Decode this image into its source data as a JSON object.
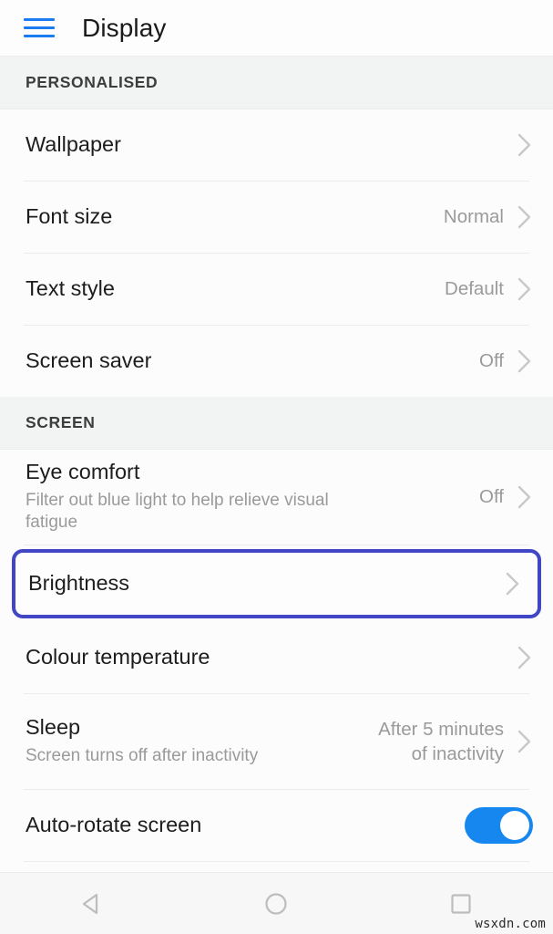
{
  "app": {
    "title": "Display",
    "menu_icon": "hamburger-menu-icon"
  },
  "sections": [
    {
      "header": "PERSONALISED",
      "rows": [
        {
          "title": "Wallpaper",
          "subtitle": "",
          "value": "",
          "accessory": "chevron"
        },
        {
          "title": "Font size",
          "subtitle": "",
          "value": "Normal",
          "accessory": "chevron"
        },
        {
          "title": "Text style",
          "subtitle": "",
          "value": "Default",
          "accessory": "chevron"
        },
        {
          "title": "Screen saver",
          "subtitle": "",
          "value": "Off",
          "accessory": "chevron"
        }
      ]
    },
    {
      "header": "SCREEN",
      "rows": [
        {
          "title": "Eye comfort",
          "subtitle": "Filter out blue light to help relieve visual fatigue",
          "value": "Off",
          "accessory": "chevron"
        },
        {
          "title": "Brightness",
          "subtitle": "",
          "value": "",
          "accessory": "chevron",
          "highlighted": true
        },
        {
          "title": "Colour temperature",
          "subtitle": "",
          "value": "",
          "accessory": "chevron"
        },
        {
          "title": "Sleep",
          "subtitle": "Screen turns off after inactivity",
          "value": "After 5 minutes\nof inactivity",
          "accessory": "chevron"
        },
        {
          "title": "Auto-rotate screen",
          "subtitle": "",
          "value": "",
          "accessory": "toggle",
          "toggle_on": true
        }
      ]
    }
  ],
  "navbar": {
    "back_label": "back-button",
    "home_label": "home-button",
    "recents_label": "recents-button"
  },
  "watermark": "wsxdn.com",
  "colors": {
    "menu_icon": "#1a7cf0",
    "highlight_border": "#4246c4",
    "toggle_on": "#1787f0",
    "section_band": "#f2f3f3",
    "value_text": "#9a9a9a",
    "title_text": "#1d1d1d",
    "nav_icon": "#bdbdbd"
  }
}
